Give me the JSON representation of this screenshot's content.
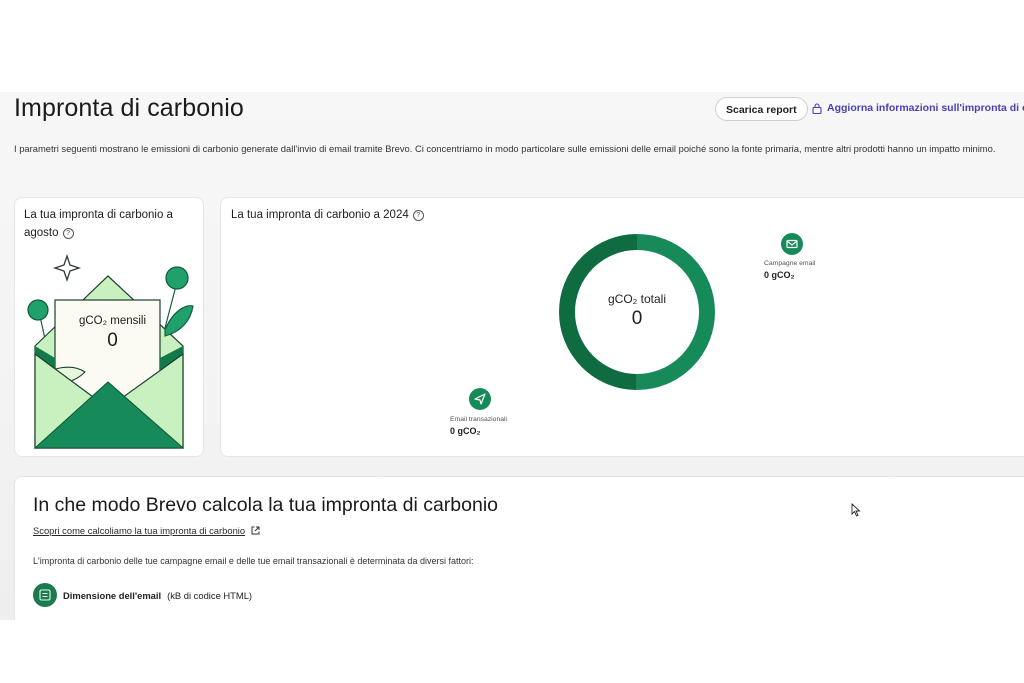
{
  "header": {
    "title": "Impronta di carbonio",
    "download_button": "Scarica report",
    "update_link": "Aggiorna informazioni sull'impronta di carbonio"
  },
  "description": "I parametri seguenti mostrano le emissioni di carbonio generate dall'invio di email tramite Brevo. Ci concentriamo in modo particolare sulle emissioni delle email poiché sono la fonte primaria, mentre altri prodotti hanno un impatto minimo.",
  "monthly_card": {
    "title": "La tua impronta di carbonio a agosto",
    "metric_label": "gCO₂ mensili",
    "metric_value": "0"
  },
  "yearly_card": {
    "title": "La tua impronta di carbonio a 2024",
    "total_label": "gCO₂ totali",
    "total_value": "0",
    "legend": [
      {
        "name": "Campagne email",
        "value": "0 gCO₂",
        "icon": "mail-icon"
      },
      {
        "name": "Email transazionali",
        "value": "0 gCO₂",
        "icon": "send-icon"
      }
    ],
    "chart_data": {
      "type": "pie",
      "categories": [
        "Campagne email",
        "Email transazionali"
      ],
      "values": [
        0,
        0
      ]
    }
  },
  "how_section": {
    "title": "In che modo Brevo calcola la tua impronta di carbonio",
    "link": "Scopri come calcoliamo la tua impronta di carbonio",
    "text": "L'impronta di carbonio delle tue campagne email e delle tue email transazionali è determinata da diversi fattori:",
    "factor_name": "Dimensione dell'email",
    "factor_detail": "(kB di codice HTML)"
  },
  "colors": {
    "brand_green": "#178a5a",
    "dark_green": "#0f6b40",
    "light_green": "#c9f1c0",
    "link_purple": "#4a3fb3"
  }
}
